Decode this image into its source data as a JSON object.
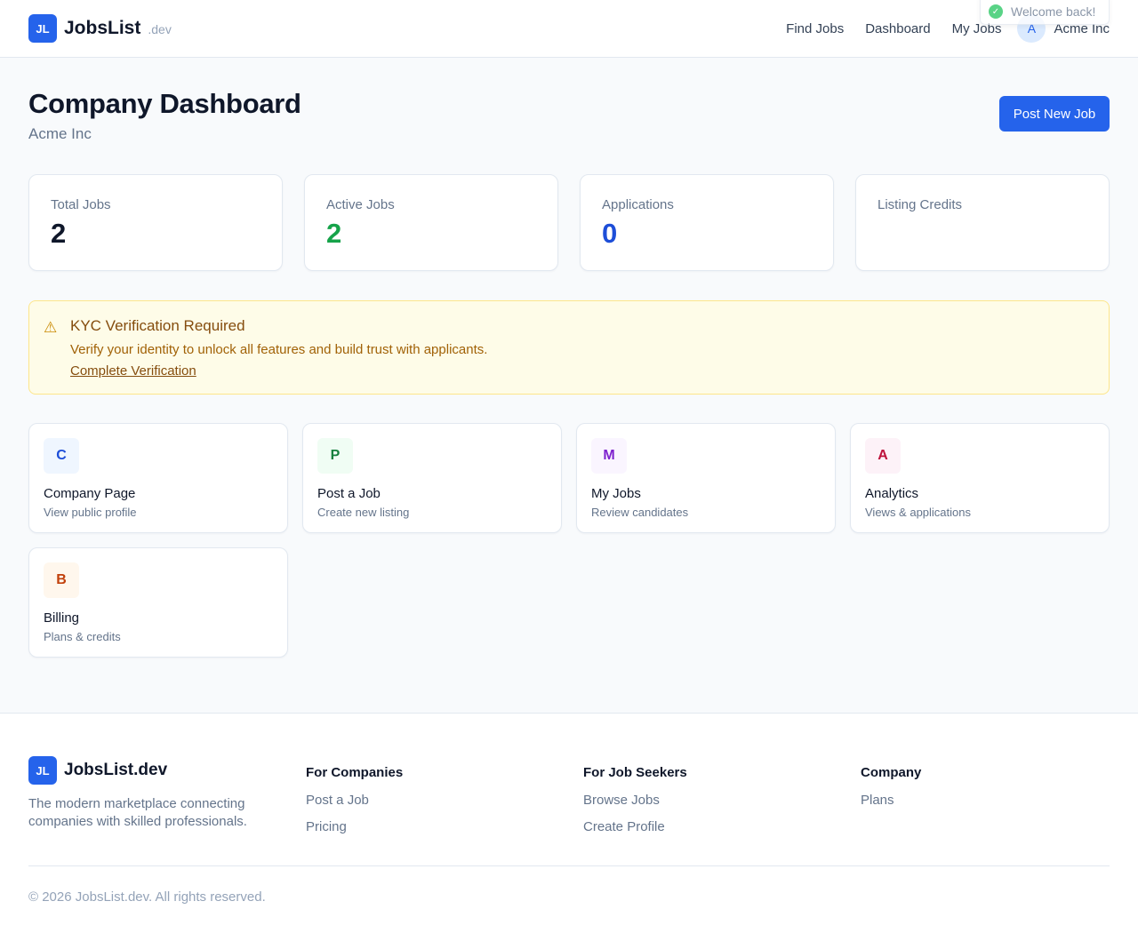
{
  "header": {
    "logo": "JL",
    "brand": "JobsList",
    "brand_suffix": ".dev",
    "nav": [
      "Find Jobs",
      "Dashboard",
      "My Jobs"
    ],
    "user_initial": "A",
    "user_name": "Acme Inc"
  },
  "toast": {
    "text": "Welcome back!",
    "icon": "check-icon"
  },
  "page": {
    "title": "Company Dashboard",
    "subtitle": "Acme Inc",
    "post_button": "Post New Job"
  },
  "stats": [
    {
      "label": "Total Jobs",
      "value": "2",
      "color": "#0f172a"
    },
    {
      "label": "Active Jobs",
      "value": "2",
      "color": "#16a34a"
    },
    {
      "label": "Applications",
      "value": "0",
      "color": "#1d4ed8"
    },
    {
      "label": "Listing Credits",
      "value": "",
      "color": "#0f172a"
    }
  ],
  "alert": {
    "icon": "warning-icon",
    "title": "KYC Verification Required",
    "text": "Verify your identity to unlock all features and build trust with applicants.",
    "link": "Complete Verification"
  },
  "actions": [
    {
      "letter": "C",
      "title": "Company Page",
      "desc": "View public profile",
      "bg": "#eff6ff",
      "fg": "#1d4ed8"
    },
    {
      "letter": "P",
      "title": "Post a Job",
      "desc": "Create new listing",
      "bg": "#f0fdf4",
      "fg": "#15803d"
    },
    {
      "letter": "M",
      "title": "My Jobs",
      "desc": "Review candidates",
      "bg": "#faf5ff",
      "fg": "#7e22ce"
    },
    {
      "letter": "A",
      "title": "Analytics",
      "desc": "Views & applications",
      "bg": "#fdf2f8",
      "fg": "#be123c"
    },
    {
      "letter": "B",
      "title": "Billing",
      "desc": "Plans & credits",
      "bg": "#fff7ed",
      "fg": "#c2410c"
    }
  ],
  "footer": {
    "logo": "JL",
    "brand": "JobsList.dev",
    "desc": "The modern marketplace connecting companies with skilled professionals.",
    "columns": [
      {
        "title": "For Companies",
        "links": [
          "Post a Job",
          "Pricing"
        ]
      },
      {
        "title": "For Job Seekers",
        "links": [
          "Browse Jobs",
          "Create Profile"
        ]
      },
      {
        "title": "Company",
        "links": [
          "Plans"
        ]
      }
    ],
    "copyright": "© 2026 JobsList.dev. All rights reserved."
  }
}
